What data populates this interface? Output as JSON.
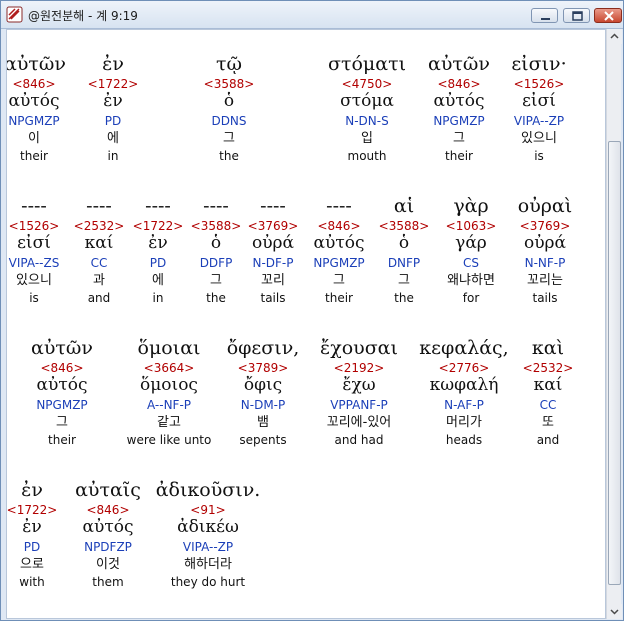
{
  "window": {
    "title": "@원전분해 - 계 9:19",
    "accent": "#6f8fb7"
  },
  "colors": {
    "strong": "#b10000",
    "parse": "#1b3fb8",
    "text": "#111111"
  },
  "rows": [
    {
      "words": [
        {
          "greek": "αὐτῶν",
          "strong": "<846>",
          "lemma": "αὐτός",
          "parse": "NPGMZP",
          "korean": "이",
          "english": "their"
        },
        {
          "greek": "ἐν",
          "strong": "<1722>",
          "lemma": "ἐν",
          "parse": "PD",
          "korean": "에",
          "english": "in"
        },
        {
          "greek": "τῷ",
          "strong": "<3588>",
          "lemma": "ὁ",
          "parse": "DDNS",
          "korean": "그",
          "english": "the"
        },
        {
          "greek": "στόματι",
          "strong": "<4750>",
          "lemma": "στόμα",
          "parse": "N-DN-S",
          "korean": "입",
          "english": "mouth"
        },
        {
          "greek": "αὐτῶν",
          "strong": "<846>",
          "lemma": "αὐτός",
          "parse": "NPGMZP",
          "korean": "그",
          "english": "their"
        },
        {
          "greek": "εἰσιν·",
          "strong": "<1526>",
          "lemma": "εἰσί",
          "parse": "VIPA--ZP",
          "korean": "있으니",
          "english": "is"
        }
      ]
    },
    {
      "words": [
        {
          "greek": "----",
          "strong": "<1526>",
          "lemma": "εἰσί",
          "parse": "VIPA--ZS",
          "korean": "있으니",
          "english": "is"
        },
        {
          "greek": "----",
          "strong": "<2532>",
          "lemma": "καί",
          "parse": "CC",
          "korean": "과",
          "english": "and"
        },
        {
          "greek": "----",
          "strong": "<1722>",
          "lemma": "ἐν",
          "parse": "PD",
          "korean": "에",
          "english": "in"
        },
        {
          "greek": "----",
          "strong": "<3588>",
          "lemma": "ὁ",
          "parse": "DDFP",
          "korean": "그",
          "english": "the"
        },
        {
          "greek": "----",
          "strong": "<3769>",
          "lemma": "οὐρά",
          "parse": "N-DF-P",
          "korean": "꼬리",
          "english": "tails"
        },
        {
          "greek": "----",
          "strong": "<846>",
          "lemma": "αὐτός",
          "parse": "NPGMZP",
          "korean": "그",
          "english": "their"
        },
        {
          "greek": "αἱ",
          "strong": "<3588>",
          "lemma": "ὁ",
          "parse": "DNFP",
          "korean": "그",
          "english": "the"
        },
        {
          "greek": "γὰρ",
          "strong": "<1063>",
          "lemma": "γάρ",
          "parse": "CS",
          "korean": "왜냐하면",
          "english": "for"
        },
        {
          "greek": "οὐραὶ",
          "strong": "<3769>",
          "lemma": "οὐρά",
          "parse": "N-NF-P",
          "korean": "꼬리는",
          "english": "tails"
        }
      ]
    },
    {
      "words": [
        {
          "greek": "αὐτῶν",
          "strong": "<846>",
          "lemma": "αὐτός",
          "parse": "NPGMZP",
          "korean": "그",
          "english": "their"
        },
        {
          "greek": "ὅμοιαι",
          "strong": "<3664>",
          "lemma": "ὅμοιος",
          "parse": "A--NF-P",
          "korean": "같고",
          "english": "were like unto"
        },
        {
          "greek": "ὄφεσιν,",
          "strong": "<3789>",
          "lemma": "ὄφις",
          "parse": "N-DM-P",
          "korean": "뱀",
          "english": "sepents"
        },
        {
          "greek": "ἔχουσαι",
          "strong": "<2192>",
          "lemma": "ἔχω",
          "parse": "VPPANF-P",
          "korean": "꼬리에-있어",
          "english": "and had"
        },
        {
          "greek": "κεφαλάς,",
          "strong": "<2776>",
          "lemma": "κωφαλή",
          "parse": "N-AF-P",
          "korean": "머리가",
          "english": "heads"
        },
        {
          "greek": "καὶ",
          "strong": "<2532>",
          "lemma": "καί",
          "parse": "CC",
          "korean": "또",
          "english": "and"
        }
      ]
    },
    {
      "words": [
        {
          "greek": "ἐν",
          "strong": "<1722>",
          "lemma": "ἐν",
          "parse": "PD",
          "korean": "으로",
          "english": "with"
        },
        {
          "greek": "αὐταῖς",
          "strong": "<846>",
          "lemma": "αὐτός",
          "parse": "NPDFZP",
          "korean": "이것",
          "english": "them"
        },
        {
          "greek": "ἀδικοῦσιν.",
          "strong": "<91>",
          "lemma": "ἀδικέω",
          "parse": "VIPA--ZP",
          "korean": "해하더라",
          "english": "they do hurt"
        }
      ]
    }
  ]
}
